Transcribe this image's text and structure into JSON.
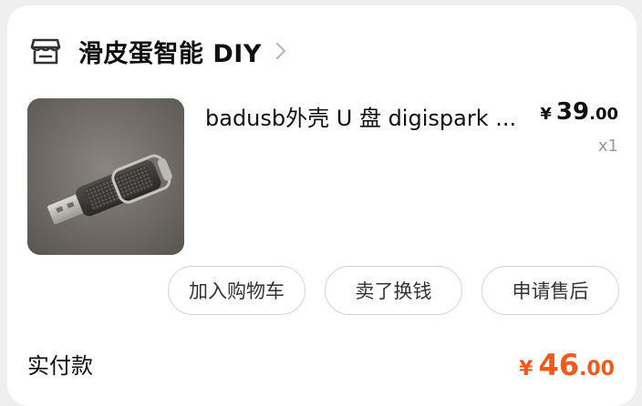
{
  "shop": {
    "name": "滑皮蛋智能 DIY",
    "icon": "store-icon"
  },
  "item": {
    "title": "badusb外壳 U 盘 digispark ...",
    "price_symbol": "¥",
    "price_integer": "39",
    "price_decimal": ".00",
    "quantity": "x1",
    "image": "usb-drive-photo"
  },
  "actions": {
    "add_to_cart": "加入购物车",
    "resell": "卖了换钱",
    "after_sales": "申请售后"
  },
  "summary": {
    "paid_label": "实付款",
    "total_symbol": "¥",
    "total_integer": "46",
    "total_decimal": ".00"
  },
  "colors": {
    "accent": "#f25a1c",
    "border": "#d6d6d6",
    "background": "#efefef"
  }
}
